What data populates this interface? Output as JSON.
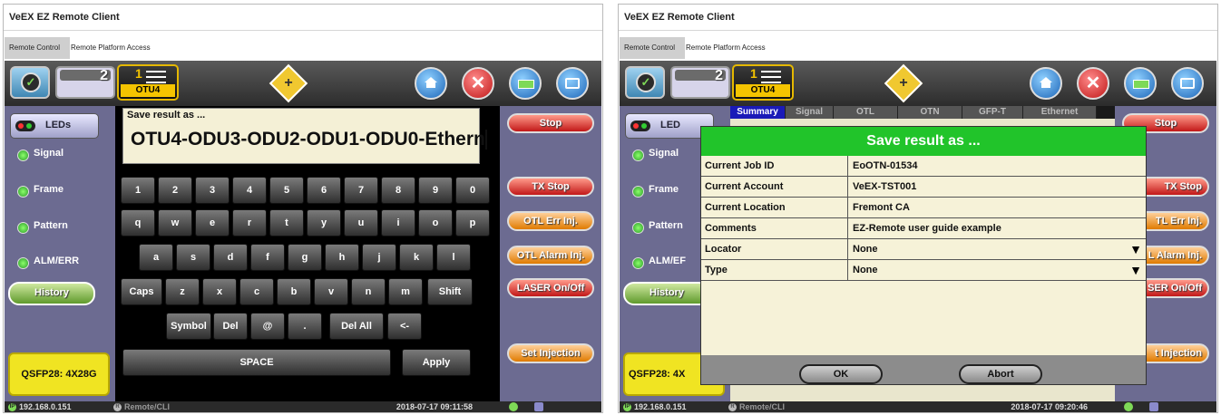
{
  "app_title": "VeEX EZ Remote Client",
  "tabs": [
    "Remote Control",
    "Remote Platform Access"
  ],
  "topbar": {
    "tab2_number": "2",
    "mode_number": "1",
    "mode_label": "OTU4"
  },
  "leds": {
    "button_label": "LEDs",
    "items": [
      "Signal",
      "Frame",
      "Pattern",
      "ALM/ERR"
    ],
    "short_label": "LED",
    "short_item": "ALM/EF"
  },
  "history_label": "History",
  "module_label": "QSFP28: 4X28G",
  "module_label_short": "QSFP28: 4X",
  "right_buttons": {
    "stop": "Stop",
    "tx_stop": "TX Stop",
    "otl_err": "OTL Err Inj.",
    "otl_alarm": "OTL Alarm Inj.",
    "laser": "LASER On/Off",
    "set_injection": "Set Injection"
  },
  "right_buttons_clipped": {
    "tx_stop": "TX Stop",
    "otl_err": "TL Err Inj.",
    "otl_alarm": "L Alarm Inj.",
    "laser": "SER On/Off",
    "set_injection": "t Injection"
  },
  "keyboard": {
    "caption": "Save result as ...",
    "value": "OTU4-ODU3-ODU2-ODU1-ODU0-Ethern",
    "row1": [
      "1",
      "2",
      "3",
      "4",
      "5",
      "6",
      "7",
      "8",
      "9",
      "0"
    ],
    "row2": [
      "q",
      "w",
      "e",
      "r",
      "t",
      "y",
      "u",
      "i",
      "o",
      "p"
    ],
    "row3": [
      "a",
      "s",
      "d",
      "f",
      "g",
      "h",
      "j",
      "k",
      "l"
    ],
    "row4_caps": "Caps",
    "row4": [
      "z",
      "x",
      "c",
      "b",
      "v",
      "n",
      "m"
    ],
    "row4_shift": "Shift",
    "row5": {
      "symbol": "Symbol",
      "del": "Del",
      "at": "@",
      "dot": ".",
      "delall": "Del All",
      "back": "<-"
    },
    "space": "SPACE",
    "apply": "Apply"
  },
  "dialog": {
    "tabs": [
      "Summary",
      "Signal",
      "OTL",
      "OTN",
      "GFP-T",
      "Ethernet"
    ],
    "title": "Save result as ...",
    "fields": [
      {
        "label": "Current Job ID",
        "value": "EoOTN-01534"
      },
      {
        "label": "Current Account",
        "value": "VeEX-TST001"
      },
      {
        "label": "Current Location",
        "value": "Fremont CA"
      },
      {
        "label": "Comments",
        "value": "EZ-Remote user guide example"
      },
      {
        "label": "Locator",
        "value": "None"
      },
      {
        "label": "Type",
        "value": "None"
      }
    ],
    "dropdown_arrow": "▼",
    "ok": "OK",
    "abort": "Abort"
  },
  "status_left": {
    "ip_badge": "IP",
    "ip": "192.168.0.151",
    "remote_badge": "R",
    "remote": "Remote/CLI",
    "datetime": "2018-07-17 09:11:58"
  },
  "status_right": {
    "ip_badge": "IP",
    "ip": "192.168.0.151",
    "remote_badge": "R",
    "remote": "Remote/CLI",
    "datetime": "2018-07-17 09:20:46"
  },
  "colors": {
    "accent_green": "#21c42a",
    "panel_purple": "#6c6b91",
    "module_yellow": "#f0e422",
    "tab_blue": "#1a1ab8"
  }
}
